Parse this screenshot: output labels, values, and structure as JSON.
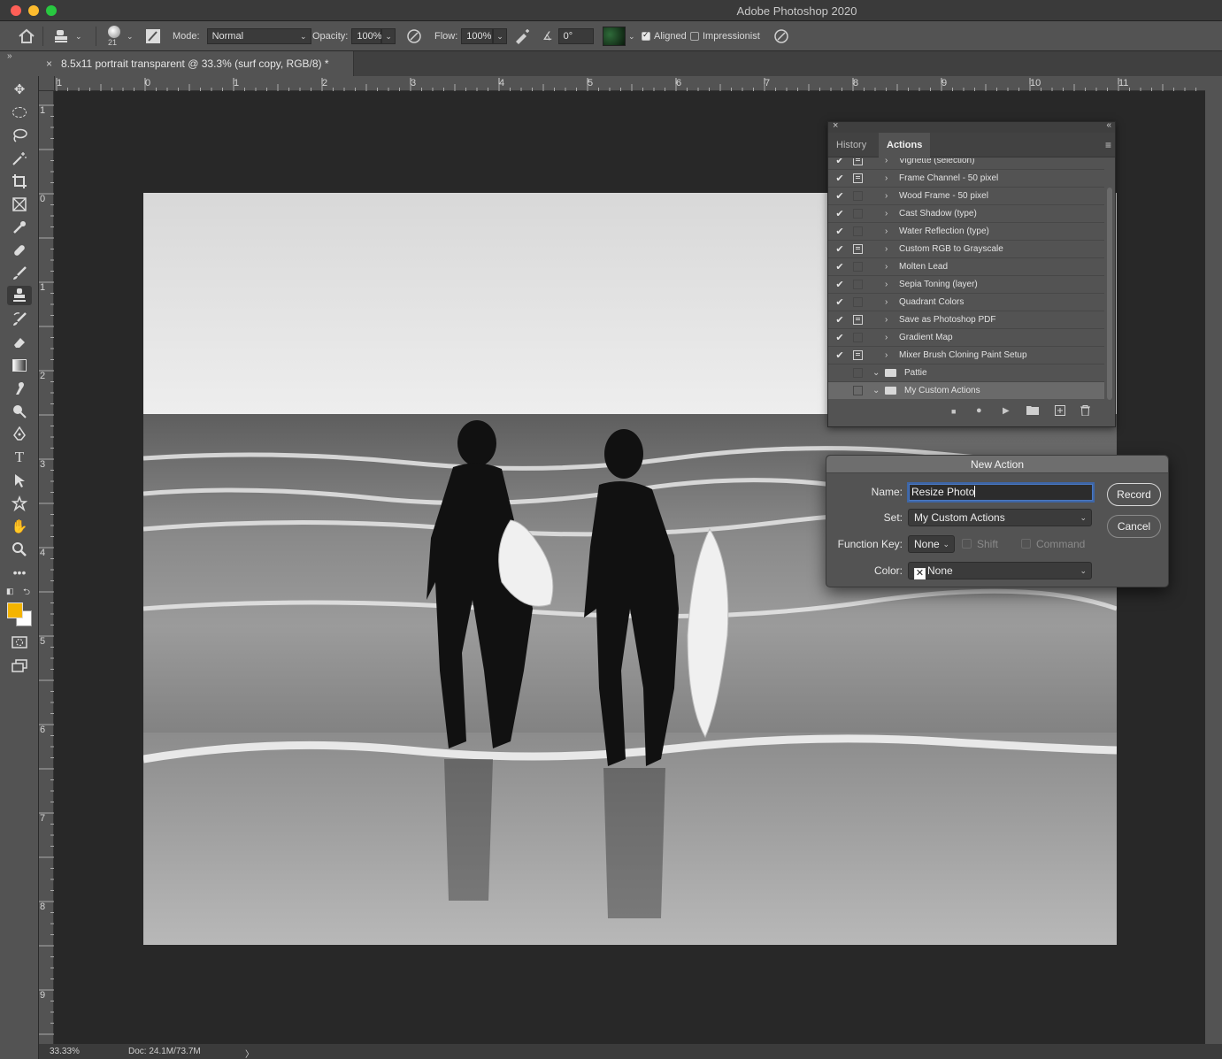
{
  "window": {
    "title": "Adobe Photoshop 2020"
  },
  "options_bar": {
    "brush_size": "21",
    "mode_label": "Mode:",
    "mode_value": "Normal",
    "opacity_label": "Opacity:",
    "opacity_value": "100%",
    "flow_label": "Flow:",
    "flow_value": "100%",
    "angle_value": "0°",
    "aligned_label": "Aligned",
    "aligned_checked": true,
    "impressionist_label": "Impressionist",
    "impressionist_checked": false
  },
  "document_tab": {
    "title": "8.5x11 portrait transparent @ 33.3% (surf copy, RGB/8) *"
  },
  "rulers": {
    "horizontal": [
      "1",
      "0",
      "1",
      "2",
      "3",
      "4",
      "5",
      "6",
      "7",
      "8",
      "9",
      "10",
      "11"
    ],
    "vertical": [
      "1",
      "0",
      "1",
      "2",
      "3",
      "4",
      "5",
      "6",
      "7",
      "8",
      "9"
    ]
  },
  "colors": {
    "foreground": "#f4b400",
    "background": "#ffffff"
  },
  "actions_panel": {
    "tabs": [
      "History",
      "Actions"
    ],
    "active_tab": "Actions",
    "rows": [
      {
        "name": "Vignette (selection)",
        "checked": true,
        "dialog": true,
        "kind": "action"
      },
      {
        "name": "Frame Channel - 50 pixel",
        "checked": true,
        "dialog": true,
        "kind": "action"
      },
      {
        "name": "Wood Frame - 50 pixel",
        "checked": true,
        "dialog": false,
        "kind": "action"
      },
      {
        "name": "Cast Shadow (type)",
        "checked": true,
        "dialog": false,
        "kind": "action"
      },
      {
        "name": "Water Reflection (type)",
        "checked": true,
        "dialog": false,
        "kind": "action"
      },
      {
        "name": "Custom RGB to Grayscale",
        "checked": true,
        "dialog": true,
        "kind": "action"
      },
      {
        "name": "Molten Lead",
        "checked": true,
        "dialog": false,
        "kind": "action"
      },
      {
        "name": "Sepia Toning (layer)",
        "checked": true,
        "dialog": false,
        "kind": "action"
      },
      {
        "name": "Quadrant Colors",
        "checked": true,
        "dialog": false,
        "kind": "action"
      },
      {
        "name": "Save as Photoshop PDF",
        "checked": true,
        "dialog": true,
        "kind": "action"
      },
      {
        "name": "Gradient Map",
        "checked": true,
        "dialog": false,
        "kind": "action"
      },
      {
        "name": "Mixer Brush Cloning Paint Setup",
        "checked": true,
        "dialog": true,
        "kind": "action"
      },
      {
        "name": "Pattie",
        "checked": false,
        "dialog": false,
        "kind": "set"
      },
      {
        "name": "My Custom Actions",
        "checked": false,
        "dialog": false,
        "kind": "set",
        "selected": true
      }
    ]
  },
  "new_action_dialog": {
    "title": "New Action",
    "name_label": "Name:",
    "name_value": "Resize Photo",
    "set_label": "Set:",
    "set_value": "My Custom Actions",
    "function_key_label": "Function Key:",
    "function_key_value": "None",
    "shift_label": "Shift",
    "command_label": "Command",
    "color_label": "Color:",
    "color_value": "None",
    "record_button": "Record",
    "cancel_button": "Cancel"
  },
  "status_bar": {
    "zoom": "33.33%",
    "doc_info": "Doc: 24.1M/73.7M",
    "arrow": "〉"
  }
}
